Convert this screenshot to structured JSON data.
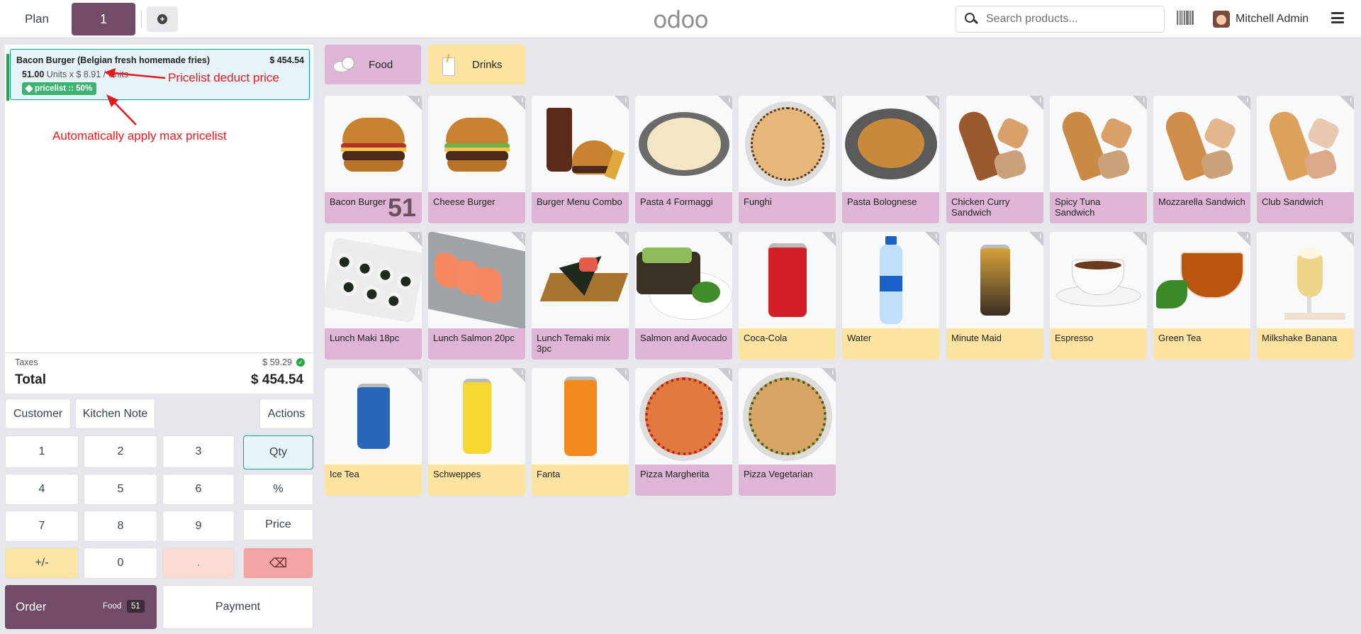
{
  "header": {
    "plan_label": "Plan",
    "order_tab_label": "1",
    "logo_text": "odoo",
    "search_placeholder": "Search products...",
    "user_name": "Mitchell Admin"
  },
  "order": {
    "line": {
      "name": "Bacon Burger (Belgian fresh homemade fries)",
      "price": "$ 454.54",
      "qty": "51.00",
      "qty_suffix": "Units x $ 8.91 / Units",
      "pricelist_tag": "pricelist :: 50%"
    },
    "annotations": {
      "deduct": "Pricelist deduct price",
      "auto_apply": "Automatically apply max pricelist"
    },
    "taxes_label": "Taxes",
    "taxes_value": "$ 59.29",
    "total_label": "Total",
    "total_value": "$ 454.54"
  },
  "actions": {
    "customer": "Customer",
    "kitchen_note": "Kitchen Note",
    "actions": "Actions"
  },
  "keypad": {
    "k1": "1",
    "k2": "2",
    "k3": "3",
    "qty": "Qty",
    "k4": "4",
    "k5": "5",
    "k6": "6",
    "percent": "%",
    "k7": "7",
    "k8": "8",
    "k9": "9",
    "price": "Price",
    "plusminus": "+/-",
    "k0": "0",
    "dot": ".",
    "backspace": "⌫"
  },
  "bottom": {
    "order_label": "Order",
    "order_category": "Food",
    "order_count": "51",
    "payment_label": "Payment"
  },
  "categories": [
    {
      "label": "Food",
      "color": "#dfb5d5"
    },
    {
      "label": "Drinks",
      "color": "#fbe4a1"
    }
  ],
  "products": [
    {
      "name": "Bacon Burger",
      "qty": "51"
    },
    {
      "name": "Cheese Burger"
    },
    {
      "name": "Burger Menu Combo"
    },
    {
      "name": "Pasta 4 Formaggi"
    },
    {
      "name": "Funghi"
    },
    {
      "name": "Pasta Bolognese"
    },
    {
      "name": "Chicken Curry Sandwich"
    },
    {
      "name": "Spicy Tuna Sandwich"
    },
    {
      "name": "Mozzarella Sandwich"
    },
    {
      "name": "Club Sandwich"
    },
    {
      "name": "Lunch Maki 18pc"
    },
    {
      "name": "Lunch Salmon 20pc"
    },
    {
      "name": "Lunch Temaki mix 3pc"
    },
    {
      "name": "Salmon and Avocado"
    },
    {
      "name": "Coca-Cola"
    },
    {
      "name": "Water"
    },
    {
      "name": "Minute Maid"
    },
    {
      "name": "Espresso"
    },
    {
      "name": "Green Tea"
    },
    {
      "name": "Milkshake Banana"
    },
    {
      "name": "Ice Tea"
    },
    {
      "name": "Schweppes"
    },
    {
      "name": "Fanta"
    },
    {
      "name": "Pizza Margherita"
    },
    {
      "name": "Pizza Vegetarian"
    }
  ],
  "colors": {
    "brand": "#714b67",
    "food": "#dfb5d5",
    "drink": "#fbe4a1",
    "annotation": "#e8181f"
  }
}
